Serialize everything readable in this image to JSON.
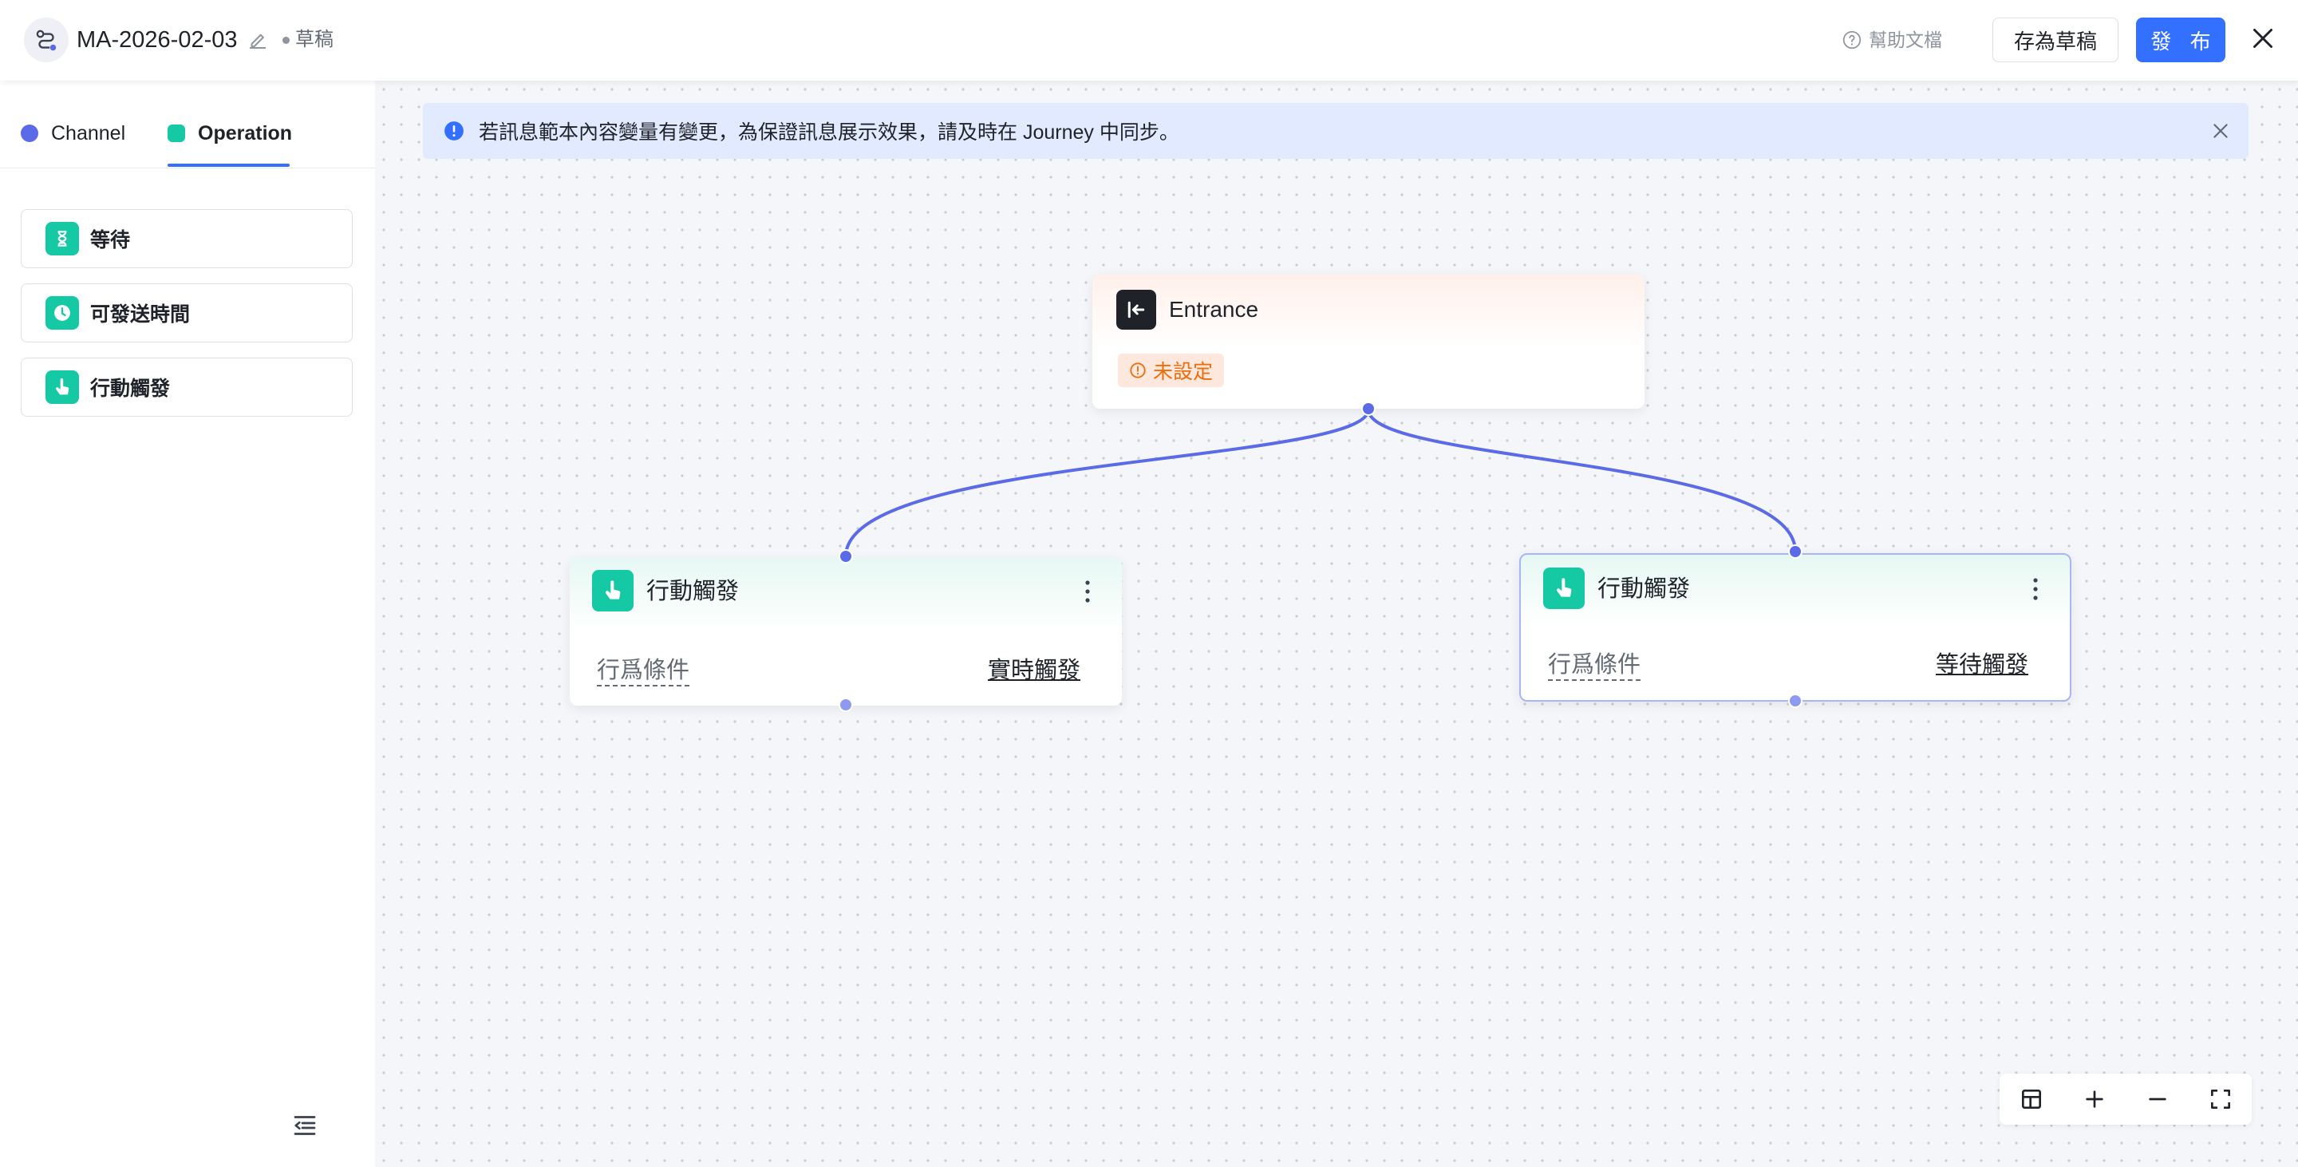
{
  "header": {
    "title": "MA-2026-02-03",
    "status": "草稿",
    "help_label": "幫助文檔",
    "save_draft_label": "存為草稿",
    "publish_label": "發 布"
  },
  "sidebar": {
    "tabs": [
      {
        "label": "Channel",
        "color": "#5b6be8"
      },
      {
        "label": "Operation",
        "color": "#14c9a4",
        "active": true
      }
    ],
    "items": [
      {
        "label": "等待",
        "icon": "hourglass-icon"
      },
      {
        "label": "可發送時間",
        "icon": "clock-icon"
      },
      {
        "label": "行動觸發",
        "icon": "tap-hand-icon"
      }
    ]
  },
  "canvas": {
    "banner_text": "若訊息範本內容變量有變更，為保證訊息展示效果，請及時在 Journey 中同步。",
    "entrance": {
      "title": "Entrance",
      "badge": "未設定"
    },
    "action_nodes": [
      {
        "title": "行動觸發",
        "condition_label": "行爲條件",
        "trigger_label": "實時觸發"
      },
      {
        "title": "行動觸發",
        "condition_label": "行爲條件",
        "trigger_label": "等待觸發",
        "selected": true
      }
    ]
  },
  "colors": {
    "accent": "#3370ff",
    "operation_green": "#14c9a4",
    "connector": "#5b6be8",
    "warning_orange": "#ed6d0c"
  }
}
